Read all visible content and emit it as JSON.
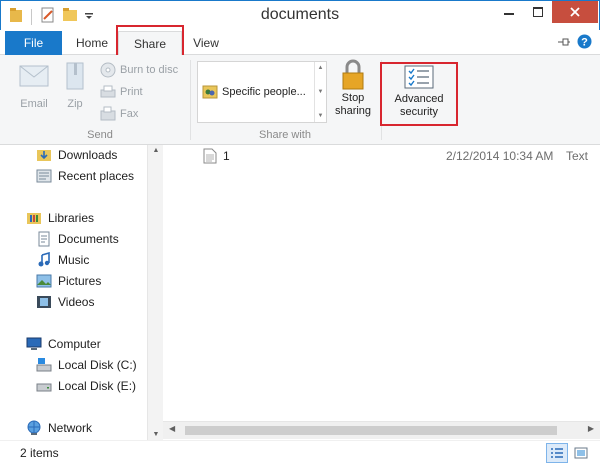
{
  "window": {
    "title": "documents"
  },
  "tabs": {
    "file": "File",
    "home": "Home",
    "share": "Share",
    "view": "View"
  },
  "ribbon": {
    "send": {
      "label": "Send",
      "email": "Email",
      "zip": "Zip",
      "burn": "Burn to disc",
      "print": "Print",
      "fax": "Fax"
    },
    "share_with": {
      "label": "Share with",
      "gallery_item": "Specific people...",
      "stop_sharing_1": "Stop",
      "stop_sharing_2": "sharing"
    },
    "advanced_security_1": "Advanced",
    "advanced_security_2": "security"
  },
  "nav": {
    "downloads": "Downloads",
    "recent": "Recent places",
    "libraries": "Libraries",
    "documents": "Documents",
    "music": "Music",
    "pictures": "Pictures",
    "videos": "Videos",
    "computer": "Computer",
    "disk_c": "Local Disk (C:)",
    "disk_e": "Local Disk (E:)",
    "network": "Network"
  },
  "files": [
    {
      "name": "1",
      "date": "2/12/2014 10:34 AM",
      "type": "Text"
    }
  ],
  "status": {
    "count": "2 items"
  },
  "colors": {
    "accent": "#1979ca",
    "highlight": "#d8262f",
    "close": "#c74e3e"
  }
}
